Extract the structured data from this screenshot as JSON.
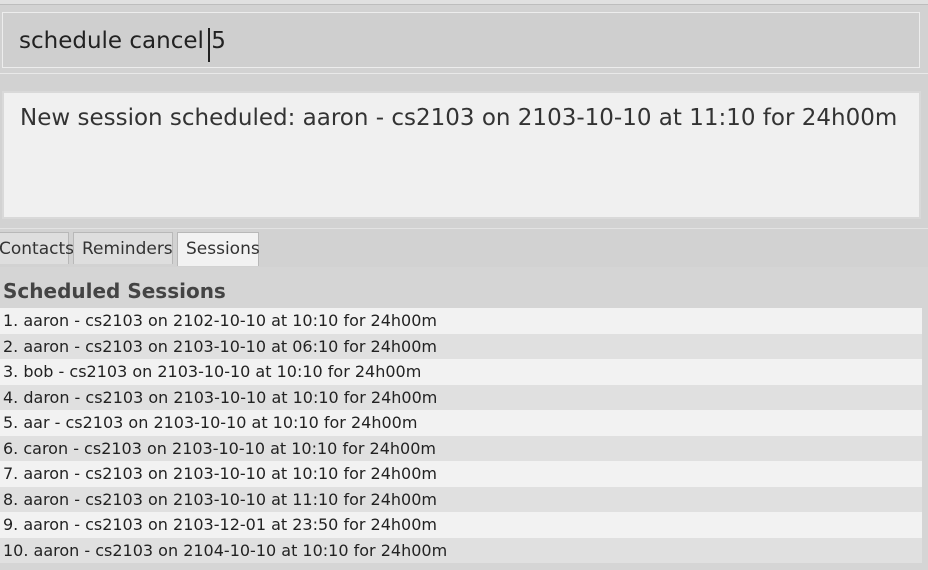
{
  "command_box": {
    "value": "schedule cancel 5"
  },
  "result_display": {
    "message": "New session scheduled: aaron - cs2103 on 2103-10-10 at 11:10 for 24h00m"
  },
  "tabs": [
    {
      "label": "Contacts",
      "active": false
    },
    {
      "label": "Reminders",
      "active": false
    },
    {
      "label": "Sessions",
      "active": true
    }
  ],
  "sessions_panel": {
    "title": "Scheduled Sessions",
    "items": [
      "1. aaron - cs2103 on 2102-10-10 at 10:10 for 24h00m",
      "2. aaron - cs2103 on 2103-10-10 at 06:10 for 24h00m",
      "3. bob - cs2103 on 2103-10-10 at 10:10 for 24h00m",
      "4. daron - cs2103 on 2103-10-10 at 10:10 for 24h00m",
      "5. aar - cs2103 on 2103-10-10 at 10:10 for 24h00m",
      "6. caron - cs2103 on 2103-10-10 at 10:10 for 24h00m",
      "7. aaron - cs2103 on 2103-10-10 at 10:10 for 24h00m",
      "8. aaron - cs2103 on 2103-10-10 at 11:10 for 24h00m",
      "9. aaron - cs2103 on 2103-12-01 at 23:50 for 24h00m",
      "10. aaron - cs2103 on 2104-10-10 at 10:10 for 24h00m"
    ]
  }
}
